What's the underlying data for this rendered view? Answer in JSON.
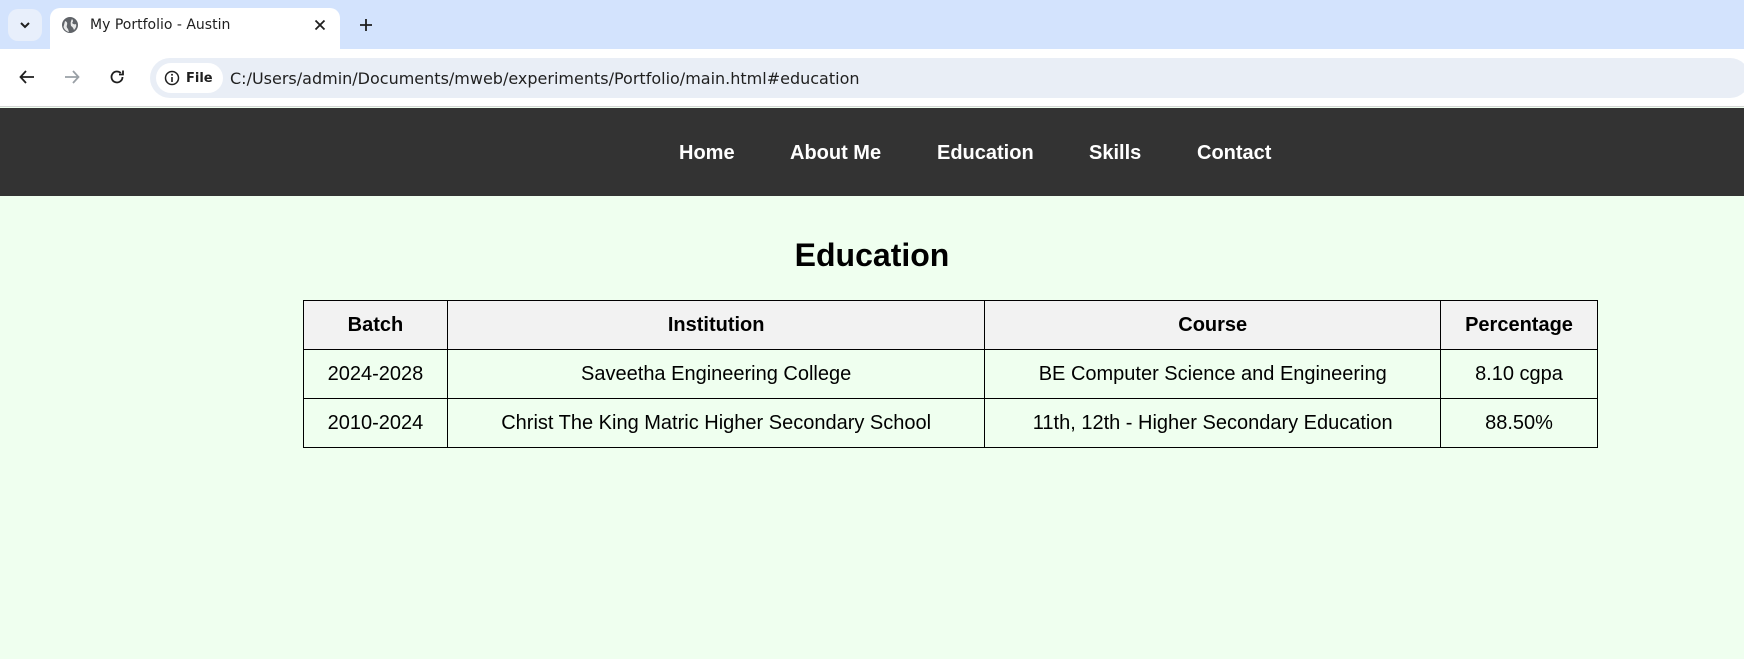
{
  "browser": {
    "tab": {
      "title": "My Portfolio - Austin",
      "icon": "globe-icon"
    },
    "address_bar": {
      "chip_label": "File",
      "url": "C:/Users/admin/Documents/mweb/experiments/Portfolio/main.html#education"
    }
  },
  "nav": {
    "items": [
      {
        "label": "Home"
      },
      {
        "label": "About Me"
      },
      {
        "label": "Education"
      },
      {
        "label": "Skills"
      },
      {
        "label": "Contact"
      }
    ]
  },
  "education": {
    "title": "Education",
    "headers": [
      "Batch",
      "Institution",
      "Course",
      "Percentage"
    ],
    "rows": [
      [
        "2024-2028",
        "Saveetha Engineering College",
        "BE Computer Science and Engineering",
        "8.10 cgpa"
      ],
      [
        "2010-2024",
        "Christ The King Matric Higher Secondary School",
        "11th, 12th - Higher Secondary Education",
        "88.50%"
      ]
    ]
  },
  "colors": {
    "page_background": "#efffef",
    "nav_background": "#333333",
    "nav_text": "#ffffff",
    "table_header_background": "#f2f2f2",
    "tab_strip": "#d3e3fd"
  }
}
